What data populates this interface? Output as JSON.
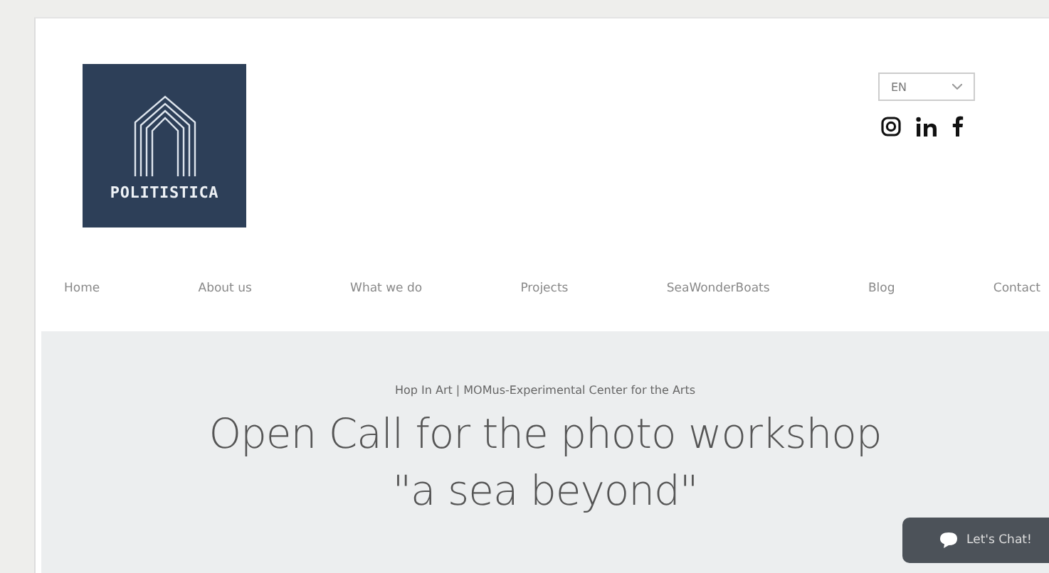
{
  "logo": {
    "name": "POLITISTICA"
  },
  "language": {
    "value": "EN"
  },
  "nav": [
    {
      "label": "Home"
    },
    {
      "label": "About us"
    },
    {
      "label": "What we do"
    },
    {
      "label": "Projects"
    },
    {
      "label": "SeaWonderBoats"
    },
    {
      "label": "Blog"
    },
    {
      "label": "Contact"
    }
  ],
  "hero": {
    "breadcrumb": "Hop In Art | MOMus-Experimental Center for the Arts",
    "title": "Open Call for the photo workshop \"a sea beyond\""
  },
  "chat": {
    "label": "Let's Chat!"
  }
}
